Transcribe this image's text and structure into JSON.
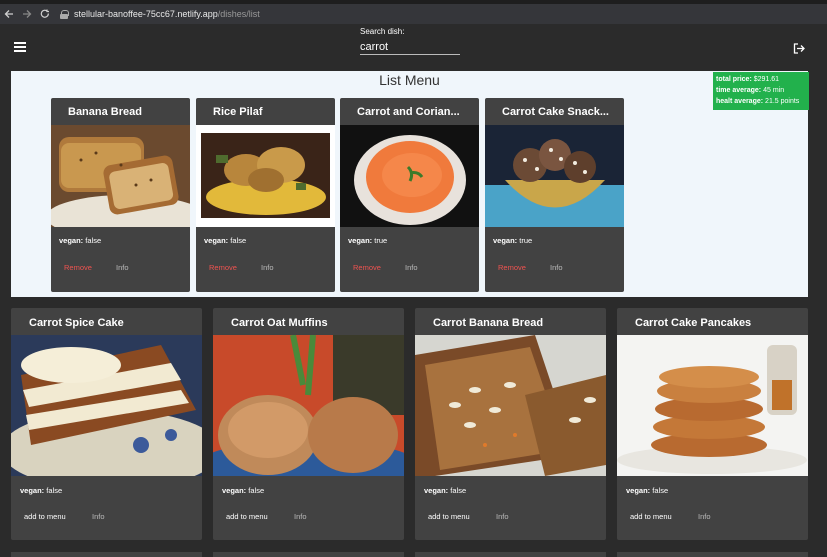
{
  "browser": {
    "url_host": "stellular-banoffee-75cc67.netlify.app",
    "url_path": "/dishes/list"
  },
  "header": {
    "search_label": "Search dish:",
    "search_value": "carrot"
  },
  "list_menu": {
    "title": "List Menu",
    "totals": {
      "price_label": "total price:",
      "price_value": "$291.61",
      "time_label": "time average:",
      "time_value": "45 min",
      "health_label": "healt average:",
      "health_value": "21.5 points"
    },
    "items": [
      {
        "name": "Banana Bread",
        "vegan_label": "vegan:",
        "vegan_value": "false",
        "remove_label": "Remove",
        "info_label": "Info"
      },
      {
        "name": "Rice Pilaf",
        "vegan_label": "vegan:",
        "vegan_value": "false",
        "remove_label": "Remove",
        "info_label": "Info"
      },
      {
        "name": "Carrot and Corian...",
        "vegan_label": "vegan:",
        "vegan_value": "true",
        "remove_label": "Remove",
        "info_label": "Info"
      },
      {
        "name": "Carrot Cake Snack...",
        "vegan_label": "vegan:",
        "vegan_value": "true",
        "remove_label": "Remove",
        "info_label": "Info"
      }
    ]
  },
  "results": [
    {
      "name": "Carrot Spice Cake",
      "vegan_label": "vegan:",
      "vegan_value": "false",
      "add_label": "add to menu",
      "info_label": "Info"
    },
    {
      "name": "Carrot Oat Muffins",
      "vegan_label": "vegan:",
      "vegan_value": "false",
      "add_label": "add to menu",
      "info_label": "Info"
    },
    {
      "name": "Carrot Banana Bread",
      "vegan_label": "vegan:",
      "vegan_value": "false",
      "add_label": "add to menu",
      "info_label": "Info"
    },
    {
      "name": "Carrot Cake Pancakes",
      "vegan_label": "vegan:",
      "vegan_value": "false",
      "add_label": "add to menu",
      "info_label": "Info"
    }
  ],
  "colors": {
    "panel_bg": "#f0f6fb",
    "totals_bg": "#22b14c",
    "card_bg": "#424242",
    "remove_color": "#ef5350"
  },
  "icons": [
    "back-arrow-icon",
    "forward-arrow-icon",
    "reload-icon",
    "lock-icon",
    "menu-icon",
    "logout-icon"
  ]
}
